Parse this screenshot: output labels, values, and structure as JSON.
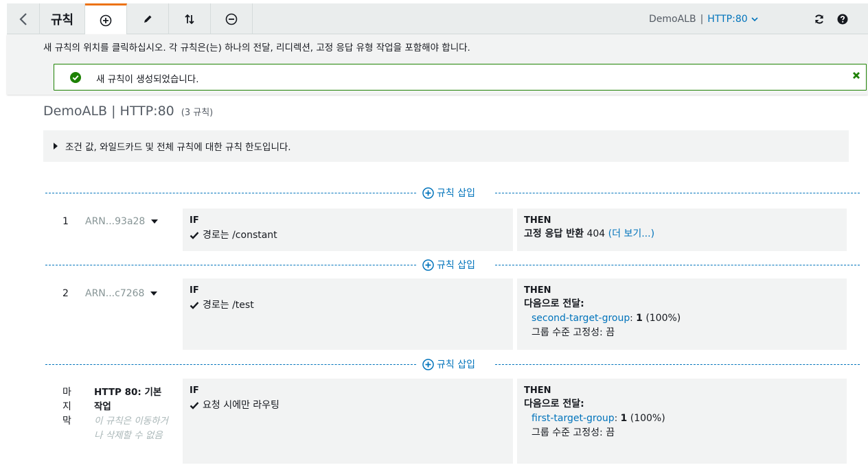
{
  "toolbar": {
    "title": "규칙",
    "listener_name": "DemoALB",
    "separator": "|",
    "listener_protocol": "HTTP:80"
  },
  "info": {
    "instruction": "새 규칙의 위치를 클릭하십시오. 각 규칙은(는) 하나의 전달, 리디렉션, 고정 응답 유형 작업을 포함해야 합니다.",
    "success_message": "새 규칙이 생성되었습니다."
  },
  "heading": {
    "title": "DemoALB | HTTP:80",
    "count": "(3 규칙)"
  },
  "limits_text": "조건 값, 와일드카드 및 전체 규칙에 대한 규칙 한도입니다.",
  "insert_label": "규칙 삽입",
  "if_label": "IF",
  "then_label": "THEN",
  "rules": [
    {
      "number": "1",
      "arn": "ARN...93a28",
      "condition": "경로는 /constant",
      "action_bold": "고정 응답 반환",
      "action_value": "404",
      "action_more": "(더 보기...)"
    },
    {
      "number": "2",
      "arn": "ARN...c7268",
      "condition": "경로는 /test",
      "forward_label": "다음으로 전달:",
      "target_group": "second-target-group",
      "weight_sep": ":",
      "weight": "1",
      "weight_pct": "(100%)",
      "stickiness": "그룹 수준 고정성: 끔"
    }
  ],
  "default_rule": {
    "last_chars": [
      "마",
      "지",
      "막"
    ],
    "title": "HTTP 80: 기본 작업",
    "note": "이 규칙은 이동하거나 삭제할 수 없음",
    "condition": "요청 시에만 라우팅",
    "forward_label": "다음으로 전달:",
    "target_group": "first-target-group",
    "weight_sep": ":",
    "weight": "1",
    "weight_pct": "(100%)",
    "stickiness": "그룹 수준 고정성: 끔"
  },
  "colors": {
    "accent": "#ec7211",
    "link": "#0073bb",
    "success": "#1d8102",
    "panel_bg": "#f2f3f3"
  }
}
